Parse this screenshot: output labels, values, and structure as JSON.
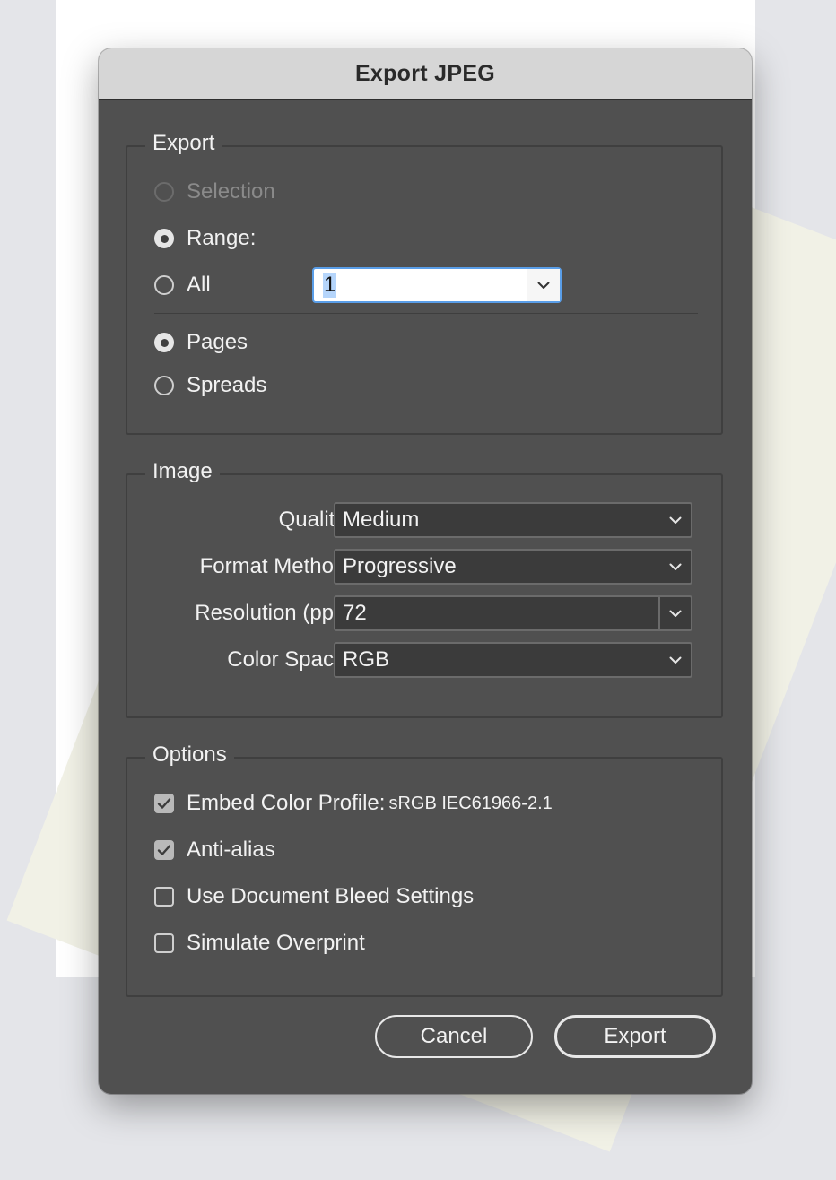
{
  "dialog": {
    "title": "Export JPEG"
  },
  "export_group": {
    "title": "Export",
    "selection_label": "Selection",
    "range_label": "Range:",
    "range_value": "1",
    "all_label": "All",
    "pages_label": "Pages",
    "spreads_label": "Spreads",
    "selected_scope": "Range",
    "selected_layout": "Pages"
  },
  "image_group": {
    "title": "Image",
    "quality_label": "Quality:",
    "quality_value": "Medium",
    "format_label": "Format Method:",
    "format_value": "Progressive",
    "resolution_label": "Resolution (ppi):",
    "resolution_value": "72",
    "colorspace_label": "Color Space:",
    "colorspace_value": "RGB"
  },
  "options_group": {
    "title": "Options",
    "embed_label": "Embed Color Profile:",
    "embed_profile": "sRGB IEC61966-2.1",
    "embed_checked": true,
    "antialias_label": "Anti-alias",
    "antialias_checked": true,
    "bleed_label": "Use Document Bleed Settings",
    "bleed_checked": false,
    "overprint_label": "Simulate Overprint",
    "overprint_checked": false
  },
  "buttons": {
    "cancel": "Cancel",
    "export": "Export"
  },
  "icons": {
    "chevron": "chevron-down-icon",
    "check": "checkmark-icon"
  },
  "colors": {
    "dialog_bg": "#505050",
    "titlebar_bg": "#d6d6d6",
    "focus_ring": "#5a9ee8"
  }
}
